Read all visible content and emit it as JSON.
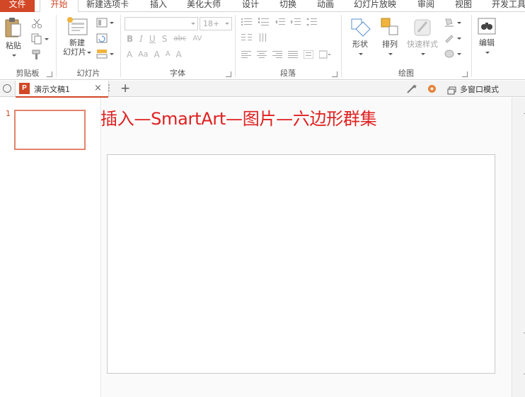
{
  "ribbon_tabs": [
    {
      "label": "文件"
    },
    {
      "label": "开始"
    },
    {
      "label": "新建选项卡"
    },
    {
      "label": "插入"
    },
    {
      "label": "美化大师"
    },
    {
      "label": "设计"
    },
    {
      "label": "切换"
    },
    {
      "label": "动画"
    },
    {
      "label": "幻灯片放映"
    },
    {
      "label": "审阅"
    },
    {
      "label": "视图"
    },
    {
      "label": "开发工具"
    }
  ],
  "groups": {
    "clipboard": {
      "label": "剪贴板",
      "paste_label": "粘贴"
    },
    "slides": {
      "label": "幻灯片",
      "new_slide_line1": "新建",
      "new_slide_line2": "幻灯片"
    },
    "font": {
      "label": "字体",
      "font_name": "",
      "font_size": "18+"
    },
    "paragraph": {
      "label": "段落"
    },
    "drawing": {
      "label": "绘图",
      "shape_label": "形状",
      "arrange_label": "排列",
      "quick_styles_label": "快速样式"
    },
    "editing": {
      "label": "编辑"
    }
  },
  "document_tab": {
    "app_icon_letter": "P",
    "name": "演示文稿1",
    "close_glyph": "×",
    "more_glyph": "⋮",
    "add_glyph": "+"
  },
  "window_mode": {
    "label": "多窗口模式"
  },
  "slide_panel": {
    "current_slide_number": "1"
  },
  "overlay_caption": "插入—SmartArt—图片—六边形群集",
  "colors": {
    "accent": "#d24726",
    "caption": "#e02020",
    "thumb_border": "#e2846b"
  }
}
